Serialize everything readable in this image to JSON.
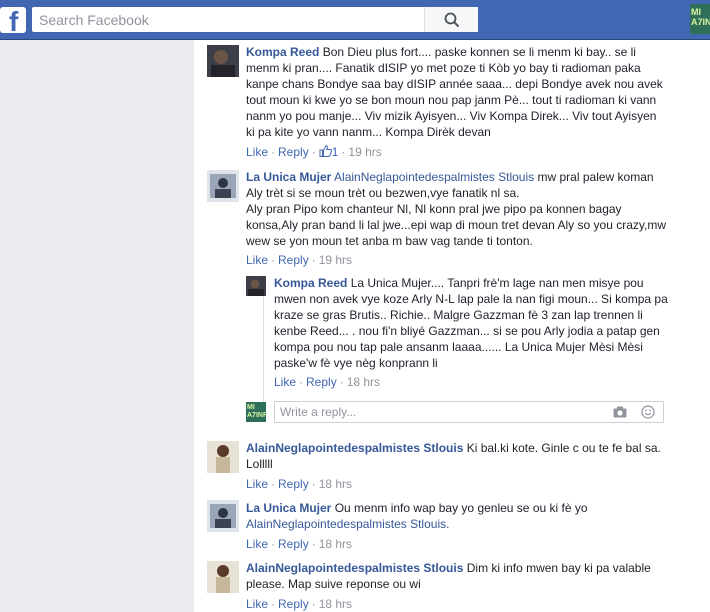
{
  "topbar": {
    "logo_letter": "f",
    "search_placeholder": "Search Facebook",
    "user_avatar_text": "MI A7INF"
  },
  "comments": [
    {
      "author": "Kompa Reed",
      "text": "Bon Dieu plus fort.... paske konnen se li menm ki bay.. se li menm ki pran.... Fanatik dISIP yo met poze ti Kòb yo bay ti radioman paka kanpe chans Bondye saa bay dISIP année saaa... depi Bondye avek nou avek tout moun ki kwe yo se bon moun nou pap janm Pè... tout ti radioman ki vann nanm yo pou manje... Viv mizik Ayisyen... Viv Kompa Direk... Viv tout Ayisyen ki pa kite yo vann nanm... Kompa Dirèk devan",
      "like": "Like",
      "reply": "Reply",
      "likes_count": "1",
      "time": "19 hrs"
    },
    {
      "author": "La Unica Mujer",
      "mention": "AlainNeglapointedespalmistes Stlouis",
      "text": "mw pral palew koman Aly trèt si se moun trèt ou bezwen,vye fanatik nl sa.\nAly pran Pipo kom chanteur Nl, Nl konn pral jwe pipo pa konnen bagay konsa,Aly pran band li lal jwe...epi wap di moun tret devan Aly so you crazy,mw wew se yon moun tet anba m baw vag tande ti tonton.",
      "like": "Like",
      "reply": "Reply",
      "time": "19 hrs"
    },
    {
      "author": "Kompa Reed",
      "text": "La Unica Mujer.... Tanpri frè'm lage nan men misye pou mwen non avek vye koze Arly N-L lap pale la nan figi moun... Si kompa pa kraze se gras Brutis.. Richie.. Malgre Gazzman fè 3 zan lap trennen li kenbe Reed... . nou fi'n bliyé Gazzman... si se pou Arly jodia a patap gen kompa pou nou tap pale ansanm laaaa...... La Unica Mujer Mèsi Mèsi paske'w fè vye nèg konprann li",
      "like": "Like",
      "reply": "Reply",
      "time": "18 hrs"
    },
    {
      "author": "AlainNeglapointedespalmistes Stlouis",
      "text": "Ki bal.ki kote. Ginle c ou te fe bal sa. Lolllll",
      "like": "Like",
      "reply": "Reply",
      "time": "18 hrs"
    },
    {
      "author": "La Unica Mujer",
      "text": "Ou menm info wap bay yo genleu se ou ki fè yo",
      "mention": "AlainNeglapointedespalmistes Stlouis.",
      "like": "Like",
      "reply": "Reply",
      "time": "18 hrs"
    },
    {
      "author": "AlainNeglapointedespalmistes Stlouis",
      "text": "Dim ki info mwen bay ki pa valable please. Map suive reponse ou wi",
      "like": "Like",
      "reply": "Reply",
      "time": "18 hrs"
    }
  ],
  "reply_box": {
    "placeholder": "Write a reply...",
    "avatar_text": "MI A7INF"
  },
  "colors": {
    "brand": "#4267b2",
    "name_link": "#365899",
    "meta": "#90949c",
    "page_bg": "#e9ebee"
  }
}
